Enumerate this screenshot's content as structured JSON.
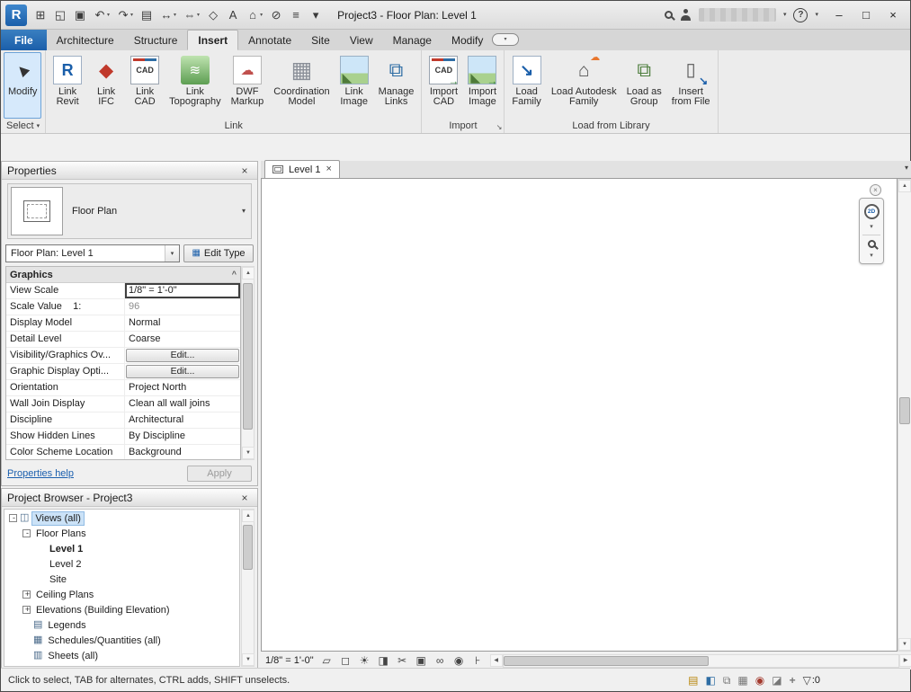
{
  "title_bar": {
    "title": "Project3 - Floor Plan: Level 1",
    "qat": [
      {
        "name": "revit-app-button",
        "icon": "revit-logo-icon"
      },
      {
        "name": "file-button",
        "icon": "file-icon"
      },
      {
        "name": "open-button",
        "icon": "open-icon"
      },
      {
        "name": "save-button",
        "icon": "save-icon"
      },
      {
        "name": "undo-button",
        "icon": "undo-icon",
        "dropdown": true
      },
      {
        "name": "redo-button",
        "icon": "redo-icon",
        "dropdown": true
      },
      {
        "name": "print-button",
        "icon": "print-icon"
      },
      {
        "name": "measure-button",
        "icon": "measure-icon",
        "dropdown": true
      },
      {
        "name": "aligned-dimension-button",
        "icon": "aligned-dimension-icon",
        "dropdown": true
      },
      {
        "name": "tag-by-category-button",
        "icon": "tag-by-category-icon"
      },
      {
        "name": "text-button",
        "icon": "text-icon"
      },
      {
        "name": "default-3d-view-button",
        "icon": "default-3d-view-icon",
        "dropdown": true
      },
      {
        "name": "section-button",
        "icon": "section-icon"
      },
      {
        "name": "thin-lines-button",
        "icon": "thin-lines-icon"
      },
      {
        "name": "customize-quick-access-button",
        "icon": "customize-quick-access-icon"
      }
    ],
    "help_label": "?"
  },
  "ribbon_tabs": [
    {
      "name": "tab-file",
      "label": "File",
      "file": true
    },
    {
      "name": "tab-architecture",
      "label": "Architecture"
    },
    {
      "name": "tab-structure",
      "label": "Structure"
    },
    {
      "name": "tab-insert",
      "label": "Insert",
      "active": true
    },
    {
      "name": "tab-annotate",
      "label": "Annotate"
    },
    {
      "name": "tab-site",
      "label": "Site"
    },
    {
      "name": "tab-view",
      "label": "View"
    },
    {
      "name": "tab-manage",
      "label": "Manage"
    },
    {
      "name": "tab-modify",
      "label": "Modify"
    }
  ],
  "ribbon": {
    "panels": [
      {
        "label": "Select",
        "buttons": [
          {
            "name": "modify-button",
            "icon": "modify-cursor-icon",
            "line1": "Modify",
            "line2": "",
            "active": true
          }
        ]
      },
      {
        "label": "Link",
        "buttons": [
          {
            "name": "link-revit-button",
            "icon": "link-revit-icon",
            "line1": "Link",
            "line2": "Revit"
          },
          {
            "name": "link-ifc-button",
            "icon": "link-ifc-icon",
            "line1": "Link",
            "line2": "IFC"
          },
          {
            "name": "link-cad-button",
            "icon": "link-cad-icon",
            "line1": "Link",
            "line2": "CAD"
          },
          {
            "name": "link-topography-button",
            "icon": "link-topography-icon",
            "line1": "Link",
            "line2": "Topography"
          },
          {
            "name": "dwf-markup-button",
            "icon": "dwf-markup-icon",
            "line1": "DWF",
            "line2": "Markup"
          },
          {
            "name": "coordination-model-button",
            "icon": "coordination-model-icon",
            "line1": "Coordination",
            "line2": "Model"
          },
          {
            "name": "link-image-button",
            "icon": "link-image-icon",
            "line1": "Link",
            "line2": "Image"
          },
          {
            "name": "manage-links-button",
            "icon": "manage-links-icon",
            "line1": "Manage",
            "line2": "Links"
          }
        ]
      },
      {
        "label": "Import",
        "launcher": true,
        "buttons": [
          {
            "name": "import-cad-button",
            "icon": "import-cad-icon",
            "line1": "Import",
            "line2": "CAD"
          },
          {
            "name": "import-image-button",
            "icon": "import-image-icon",
            "line1": "Import",
            "line2": "Image"
          }
        ]
      },
      {
        "label": "Load from Library",
        "buttons": [
          {
            "name": "load-family-button",
            "icon": "load-family-icon",
            "line1": "Load",
            "line2": "Family"
          },
          {
            "name": "load-autodesk-family-button",
            "icon": "load-autodesk-family-icon",
            "line1": "Load Autodesk",
            "line2": "Family"
          },
          {
            "name": "load-as-group-button",
            "icon": "load-as-group-icon",
            "line1": "Load as",
            "line2": "Group"
          },
          {
            "name": "insert-from-file-button",
            "icon": "insert-from-file-icon",
            "line1": "Insert",
            "line2": "from File"
          }
        ]
      }
    ]
  },
  "properties": {
    "title": "Properties",
    "type_name": "Floor Plan",
    "instance_value": "Floor Plan: Level 1",
    "edit_type_label": "Edit Type",
    "section_label": "Graphics",
    "rows": [
      {
        "label": "View Scale",
        "value": "1/8\" = 1'-0\"",
        "kind": "input",
        "selected": true
      },
      {
        "label": "Scale Value    1:",
        "value": "96",
        "kind": "disabled"
      },
      {
        "label": "Display Model",
        "value": "Normal",
        "kind": "text"
      },
      {
        "label": "Detail Level",
        "value": "Coarse",
        "kind": "text"
      },
      {
        "label": "Visibility/Graphics Ov...",
        "value": "Edit...",
        "kind": "button"
      },
      {
        "label": "Graphic Display Opti...",
        "value": "Edit...",
        "kind": "button"
      },
      {
        "label": "Orientation",
        "value": "Project North",
        "kind": "text"
      },
      {
        "label": "Wall Join Display",
        "value": "Clean all wall joins",
        "kind": "text"
      },
      {
        "label": "Discipline",
        "value": "Architectural",
        "kind": "text"
      },
      {
        "label": "Show Hidden Lines",
        "value": "By Discipline",
        "kind": "text"
      },
      {
        "label": "Color Scheme Location",
        "value": "Background",
        "kind": "text"
      }
    ],
    "help_link": "Properties help",
    "apply_label": "Apply"
  },
  "project_browser": {
    "title": "Project Browser - Project3",
    "rows": [
      {
        "indent": 0,
        "expander": "minus",
        "icon": "views-icon",
        "label": "Views (all)",
        "selected": true
      },
      {
        "indent": 1,
        "expander": "minus",
        "label": "Floor Plans"
      },
      {
        "indent": 2,
        "label": "Level 1",
        "bold": true
      },
      {
        "indent": 2,
        "label": "Level 2"
      },
      {
        "indent": 2,
        "label": "Site"
      },
      {
        "indent": 1,
        "expander": "plus",
        "label": "Ceiling Plans"
      },
      {
        "indent": 1,
        "expander": "plus",
        "label": "Elevations (Building Elevation)"
      },
      {
        "indent": 1,
        "icon": "legend-icon",
        "label": "Legends"
      },
      {
        "indent": 1,
        "icon": "schedule-icon",
        "label": "Schedules/Quantities (all)"
      },
      {
        "indent": 1,
        "icon": "sheet-icon",
        "label": "Sheets (all)"
      }
    ]
  },
  "drawing": {
    "tab_label": "Level 1",
    "view_scale": "1/8\" = 1'-0\"",
    "nav_wheel_label": "2D",
    "view_controls": [
      {
        "icon": "detail-level-icon"
      },
      {
        "icon": "visual-style-icon"
      },
      {
        "icon": "sun-path-icon"
      },
      {
        "icon": "shadows-icon"
      },
      {
        "icon": "crop-view-icon"
      },
      {
        "icon": "show-crop-region-icon"
      },
      {
        "icon": "temporary-hide-isolate-icon"
      },
      {
        "icon": "reveal-hidden-elements-icon"
      },
      {
        "icon": "reveal-constraints-icon"
      }
    ]
  },
  "status_bar": {
    "message": "Click to select, TAB for alternates, CTRL adds, SHIFT unselects.",
    "toggles": [
      {
        "icon": "worksets-icon"
      },
      {
        "icon": "design-options-icon"
      },
      {
        "icon": "select-links-toggle-icon"
      },
      {
        "icon": "select-underlay-toggle-icon"
      },
      {
        "icon": "select-pinned-toggle-icon"
      },
      {
        "icon": "select-by-face-toggle-icon"
      },
      {
        "icon": "press-drag-toggle-icon"
      }
    ],
    "filter_count": ":0"
  }
}
